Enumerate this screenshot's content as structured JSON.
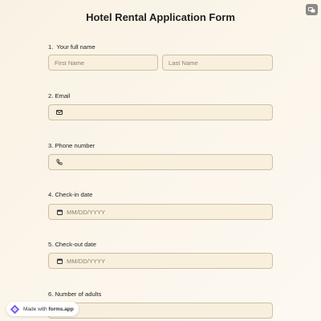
{
  "form": {
    "title": "Hotel Rental Application Form"
  },
  "questions": {
    "full_name": {
      "label": "1.  Your full name",
      "first_placeholder": "First Name",
      "last_placeholder": "Last Name"
    },
    "email": {
      "label": "2. Email",
      "icon": "envelope-icon"
    },
    "phone": {
      "label": "3. Phone number",
      "icon": "phone-icon"
    },
    "check_in": {
      "label": "4. Check-in date",
      "placeholder": "MM/DD/YYYY",
      "icon": "calendar-icon"
    },
    "check_out": {
      "label": "5. Check-out date",
      "placeholder": "MM/DD/YYYY",
      "icon": "calendar-icon"
    },
    "adults": {
      "label": "6. Number of adults"
    }
  },
  "badge": {
    "prefix": "Made with ",
    "brand": "forms.app"
  },
  "colors": {
    "background": "#fbf5ea",
    "input_bg": "#f8efdd",
    "input_border": "#cdbfa5",
    "corner_button": "#8b8882",
    "brand_logo": "#7b5cf0"
  }
}
